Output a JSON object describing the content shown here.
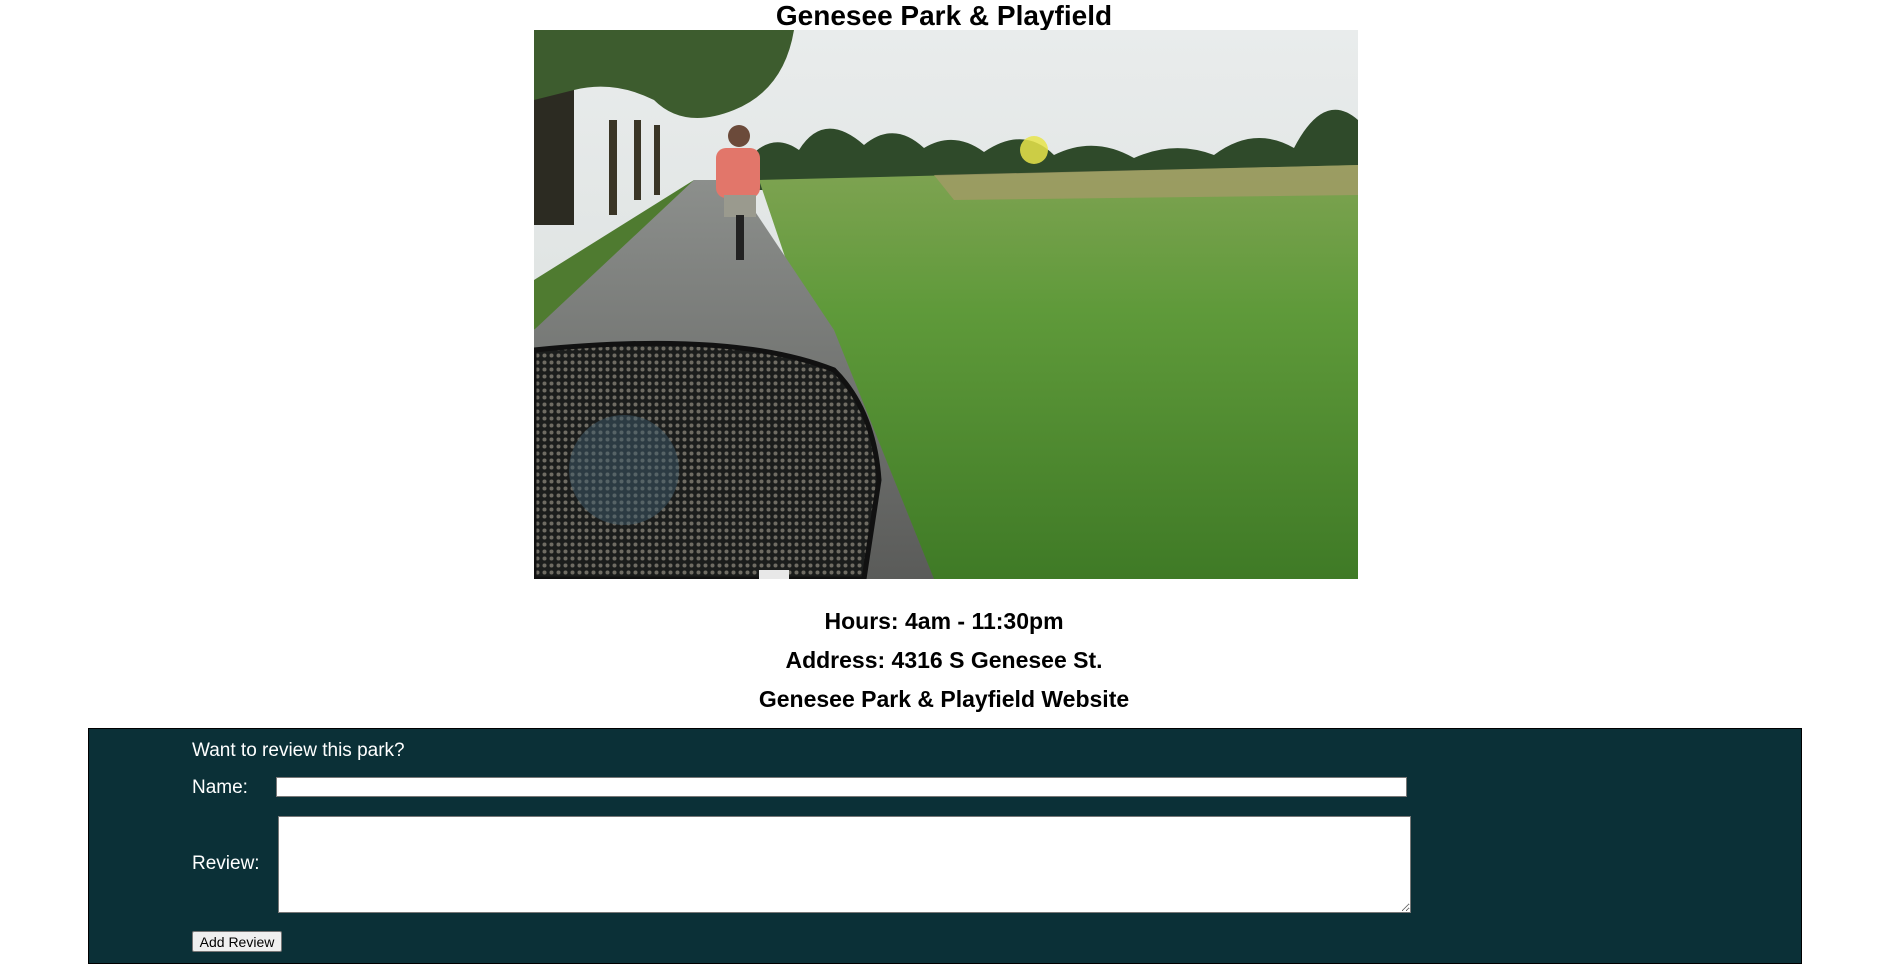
{
  "park": {
    "title": "Genesee Park & Playfield",
    "photo_alt": "Genesee Park & Playfield",
    "hours": "Hours: 4am - 11:30pm",
    "address": "Address: 4316 S Genesee St.",
    "website_link": "Genesee Park & Playfield Website"
  },
  "review_form": {
    "prompt": "Want to review this park?",
    "name_label": "Name:",
    "name_value": "",
    "review_label": "Review:",
    "review_value": "",
    "submit_label": "Add Review"
  },
  "colors": {
    "panel_background": "#0b3037",
    "panel_text": "#ffffff"
  }
}
